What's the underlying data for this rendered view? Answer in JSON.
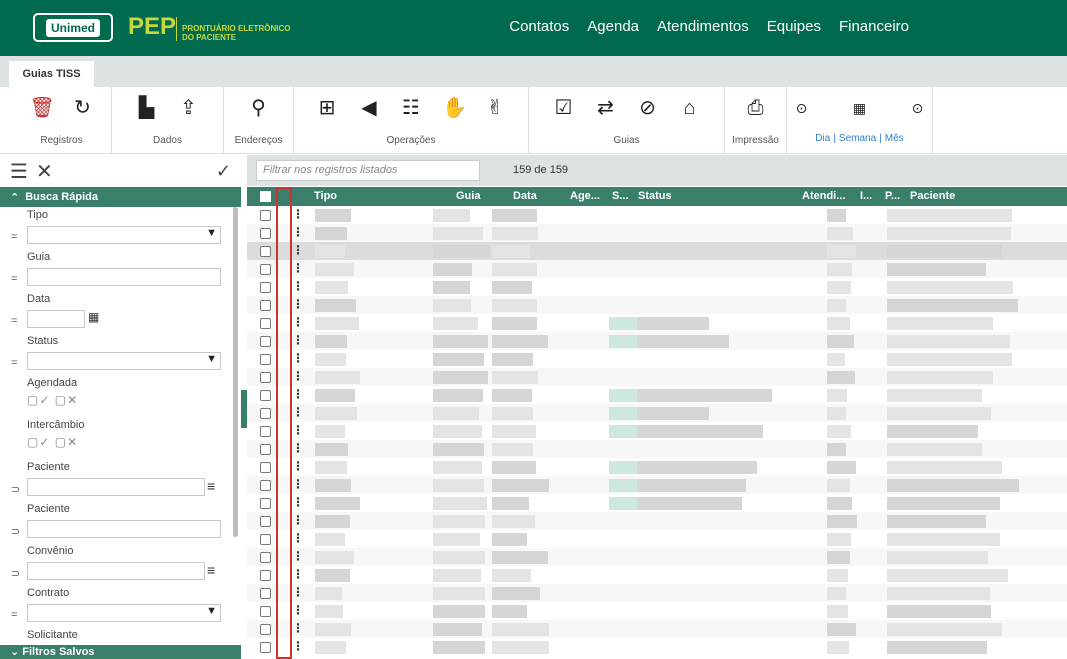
{
  "header": {
    "logo_text": "Unimed",
    "app_name": "PEP",
    "app_subtitle_line1": "PRONTUÁRIO ELETRÔNICO",
    "app_subtitle_line2": "DO PACIENTE",
    "nav": [
      "Contatos",
      "Agenda",
      "Atendimentos",
      "Equipes",
      "Financeiro"
    ]
  },
  "tabs": [
    {
      "label": "Guias TISS"
    }
  ],
  "toolbar": {
    "groups": [
      {
        "label": "Registros",
        "icons": [
          "trash-icon",
          "refresh-icon"
        ]
      },
      {
        "label": "Dados",
        "icons": [
          "document-chart-icon",
          "share-icon"
        ]
      },
      {
        "label": "Endereços",
        "icons": [
          "location-pin-icon"
        ]
      },
      {
        "label": "Operações",
        "icons": [
          "clipboard-plus-icon",
          "megaphone-icon",
          "list-icon",
          "hands-icon",
          "handshake-icon"
        ]
      },
      {
        "label": "Guias",
        "icons": [
          "check-square-icon",
          "swap-square-icon",
          "cancel-square-icon",
          "home-square-icon"
        ]
      },
      {
        "label": "Impressão",
        "icons": [
          "printer-icon"
        ]
      }
    ],
    "period": {
      "day": "Dia",
      "week": "Semana",
      "month": "Mês"
    }
  },
  "left_panel": {
    "section_title": "Busca Rápida",
    "footer_title": "Filtros Salvos",
    "fields": [
      {
        "label": "Tipo",
        "op": "=",
        "kind": "select"
      },
      {
        "label": "Guia",
        "op": "=",
        "kind": "text"
      },
      {
        "label": "Data",
        "op": "=",
        "kind": "date"
      },
      {
        "label": "Status",
        "op": "=",
        "kind": "select"
      },
      {
        "label": "Agendada",
        "op": "",
        "kind": "toggle"
      },
      {
        "label": "Intercâmbio",
        "op": "",
        "kind": "toggle"
      },
      {
        "label": "Paciente",
        "op": "⊃",
        "kind": "lookup"
      },
      {
        "label": "Paciente",
        "op": "⊃",
        "kind": "text"
      },
      {
        "label": "Convênio",
        "op": "⊃",
        "kind": "lookup"
      },
      {
        "label": "Contrato",
        "op": "=",
        "kind": "select"
      },
      {
        "label": "Solicitante",
        "op": "",
        "kind": "text"
      }
    ]
  },
  "grid": {
    "filter_placeholder": "Filtrar nos registros listados",
    "count": "159 de 159",
    "columns": [
      "Tipo",
      "Guia",
      "Data",
      "Age...",
      "S...",
      "Status",
      "Atendi...",
      "I...",
      "P...",
      "Paciente"
    ],
    "row_count": 25,
    "highlight_row": 2
  }
}
